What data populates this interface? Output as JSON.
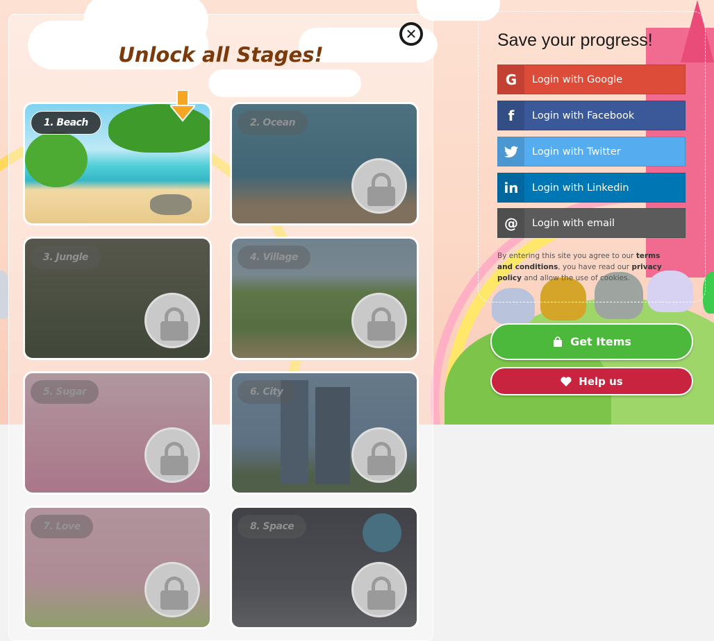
{
  "modal": {
    "title": "Unlock all Stages!",
    "close_icon": "close-icon"
  },
  "stages": [
    {
      "label": "1. Beach",
      "locked": false
    },
    {
      "label": "2. Ocean",
      "locked": true
    },
    {
      "label": "3. Jungle",
      "locked": true
    },
    {
      "label": "4. Village",
      "locked": true
    },
    {
      "label": "5. Sugar",
      "locked": true
    },
    {
      "label": "6. City",
      "locked": true
    },
    {
      "label": "7. Love",
      "locked": true
    },
    {
      "label": "8. Space",
      "locked": true
    }
  ],
  "save": {
    "title": "Save your progress!",
    "logins": [
      {
        "label": "Login with Google",
        "icon": "google-icon",
        "glyph": "G",
        "color": "#dd4b39"
      },
      {
        "label": "Login with Facebook",
        "icon": "facebook-icon",
        "glyph": "f",
        "color": "#3b5998"
      },
      {
        "label": "Login with Twitter",
        "icon": "twitter-icon",
        "glyph": "🐦",
        "color": "#55acee"
      },
      {
        "label": "Login with Linkedin",
        "icon": "linkedin-icon",
        "glyph": "in",
        "color": "#0077b5"
      },
      {
        "label": "Login with email",
        "icon": "at-icon",
        "glyph": "@",
        "color": "#5b5b5b"
      }
    ],
    "terms": {
      "pre": "By entering this site you agree to our ",
      "terms_link": "terms and conditions",
      "mid": ", you have read our ",
      "privacy_link": "privacy policy",
      "post": " and allow the use of cookies."
    }
  },
  "actions": {
    "get_items": {
      "label": "Get Items",
      "icon": "shopping-bag-icon",
      "color": "#4cb83c"
    },
    "help_us": {
      "label": "Help us",
      "icon": "heart-icon",
      "color": "#c8243f"
    }
  }
}
